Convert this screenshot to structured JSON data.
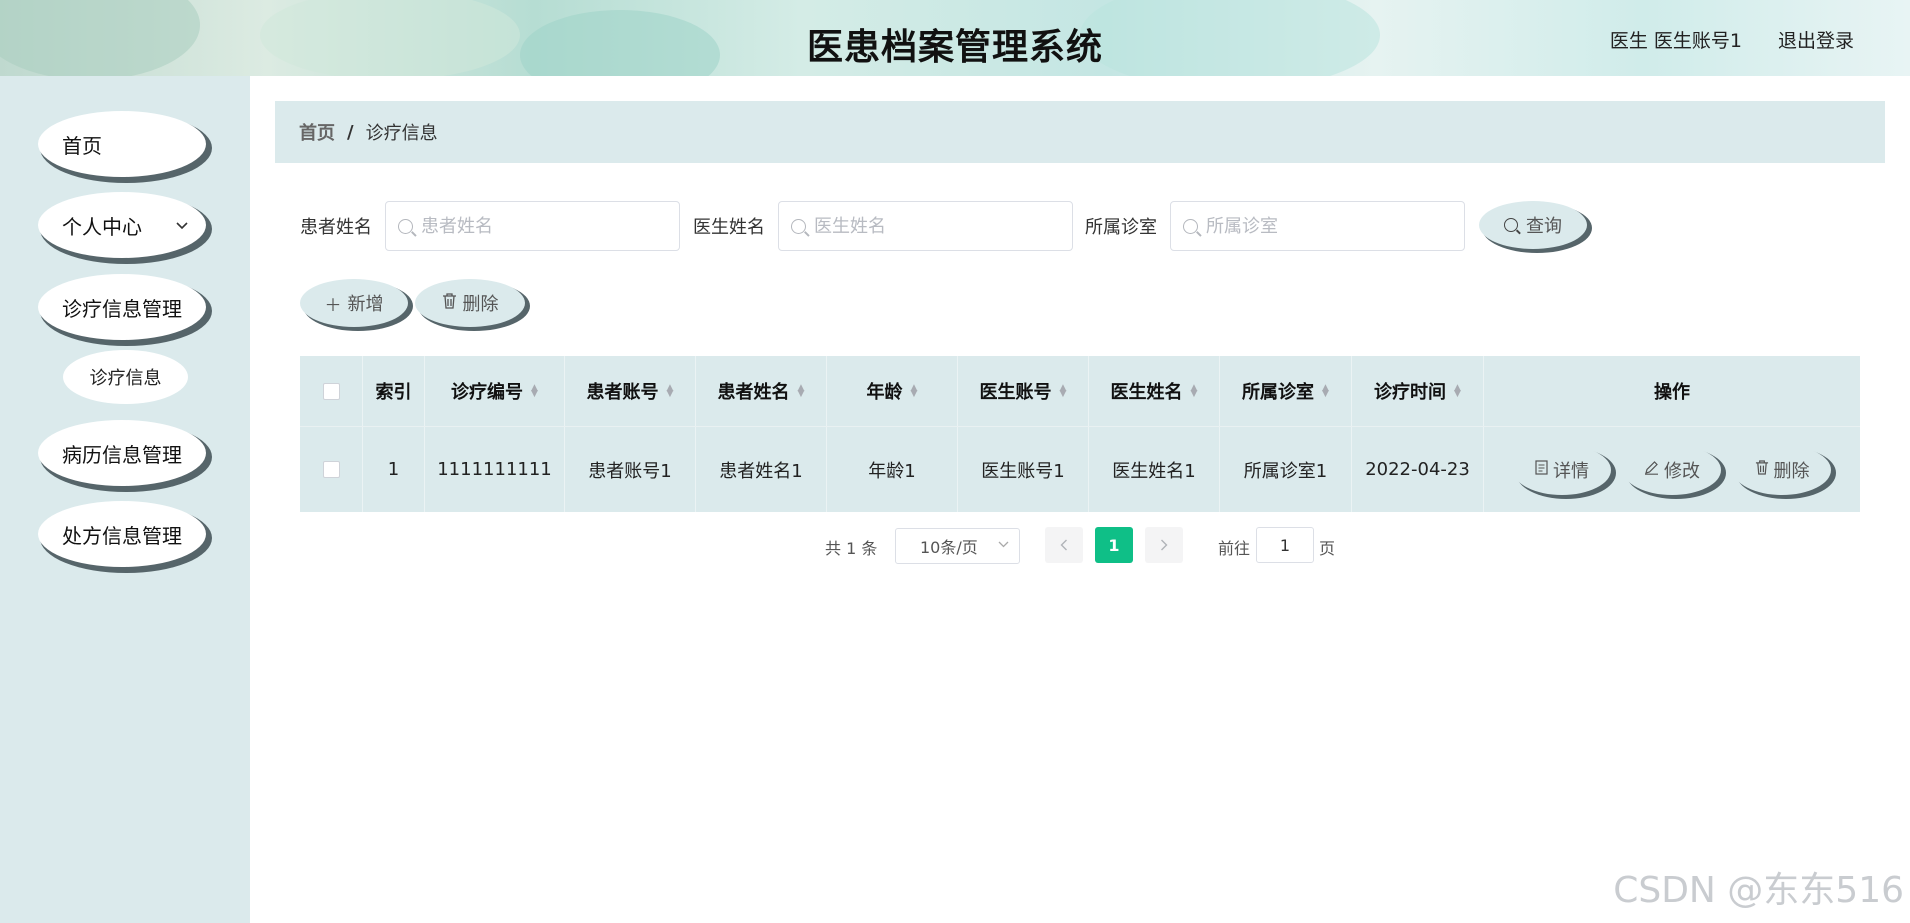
{
  "header": {
    "title": "医患档案管理系统",
    "user": "医生 医生账号1",
    "logout": "退出登录"
  },
  "sidebar": {
    "items": [
      {
        "label": "首页"
      },
      {
        "label": "个人中心",
        "chevron": "chevron-down-icon"
      },
      {
        "label": "诊疗信息管理"
      },
      {
        "label": "病历信息管理"
      },
      {
        "label": "处方信息管理"
      }
    ],
    "sub_item": "诊疗信息"
  },
  "breadcrumb": {
    "home": "首页",
    "separator": "/",
    "current": "诊疗信息"
  },
  "search": {
    "fields": [
      {
        "label": "患者姓名",
        "placeholder": "患者姓名",
        "value": ""
      },
      {
        "label": "医生姓名",
        "placeholder": "医生姓名",
        "value": ""
      },
      {
        "label": "所属诊室",
        "placeholder": "所属诊室",
        "value": ""
      }
    ],
    "query_label": "查询"
  },
  "actions": {
    "add_label": "新增",
    "delete_label": "删除"
  },
  "table": {
    "columns": [
      "索引",
      "诊疗编号",
      "患者账号",
      "患者姓名",
      "年龄",
      "医生账号",
      "医生姓名",
      "所属诊室",
      "诊疗时间",
      "操作"
    ],
    "rows": [
      {
        "index": "1",
        "no": "1111111111",
        "patient_account": "患者账号1",
        "patient_name": "患者姓名1",
        "age": "年龄1",
        "doctor_account": "医生账号1",
        "doctor_name": "医生姓名1",
        "room": "所属诊室1",
        "time": "2022-04-23"
      }
    ],
    "row_actions": {
      "detail": "详情",
      "edit": "修改",
      "delete": "删除"
    }
  },
  "pagination": {
    "total": "共 1 条",
    "page_size": "10条/页",
    "current_page": "1",
    "goto_label": "前往",
    "goto_value": "1",
    "page_suffix": "页"
  },
  "watermark": "CSDN @东东516",
  "colors": {
    "accent": "#0fbf87",
    "panel": "#dbeaec",
    "button_shadow": "#56656a"
  }
}
